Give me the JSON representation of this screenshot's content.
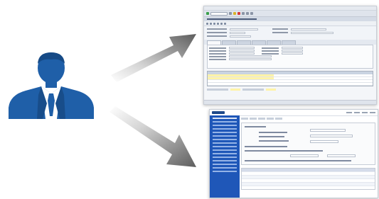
{
  "illustration": {
    "user_icon": "businessman-icon",
    "arrows": [
      "arrow-up-right-icon",
      "arrow-down-right-icon"
    ],
    "colors": {
      "user_blue": "#1f5fa8",
      "arrow_gray": "#6e6e6e",
      "portal_sidebar": "#1f57b8"
    }
  },
  "screens": [
    {
      "kind": "desktop-erp-window"
    },
    {
      "kind": "web-portal-window"
    }
  ]
}
